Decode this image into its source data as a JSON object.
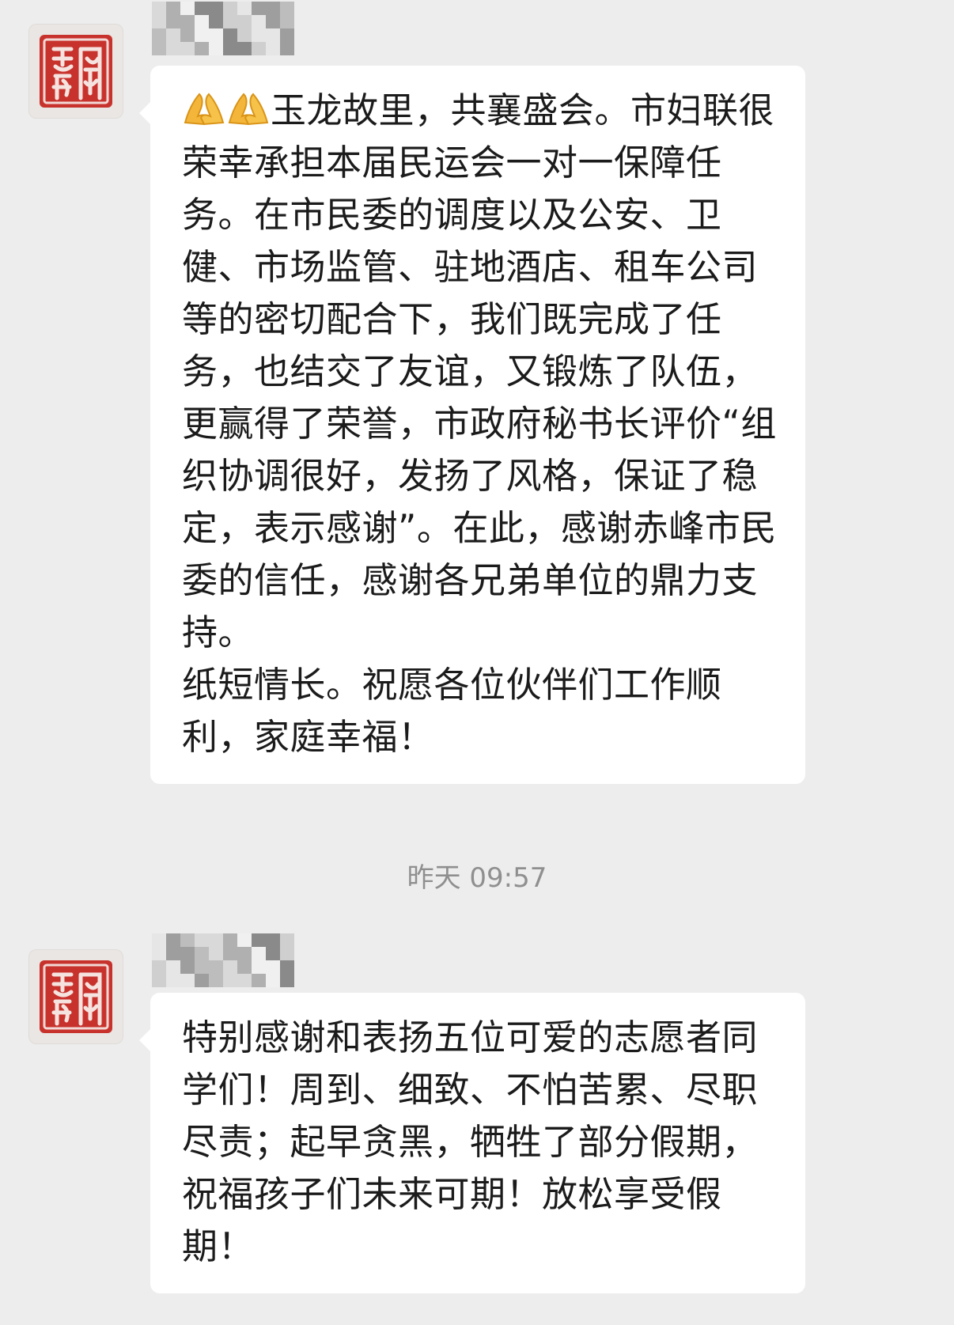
{
  "messages": [
    {
      "sender_avatar": "red-seal-avatar",
      "icons": [
        "folded-hands-emoji",
        "folded-hands-emoji"
      ],
      "paragraphs": [
        "玉龙故里，共襄盛会。市妇联很荣幸承担本届民运会一对一保障任务。在市民委的调度以及公安、卫健、市场监管、驻地酒店、租车公司等的密切配合下，我们既完成了任务，也结交了友谊，又锻炼了队伍，更赢得了荣誉，市政府秘书长评价“组织协调很好，发扬了风格，保证了稳定，表示感谢”。在此，感谢赤峰市民委的信任，感谢各兄弟单位的鼎力支持。",
        "纸短情长。祝愿各位伙伴们工作顺利，家庭幸福！"
      ]
    },
    {
      "sender_avatar": "red-seal-avatar",
      "paragraphs": [
        "特别感谢和表扬五位可爱的志愿者同学们！周到、细致、不怕苦累、尽职尽责；起早贪黑，牺牲了部分假期，祝福孩子们未来可期！放松享受假期！"
      ]
    }
  ],
  "timestamp": "昨天 09:57",
  "colors": {
    "background": "#ededed",
    "bubble": "#ffffff",
    "seal_red": "#c8322c",
    "timestamp": "#8f8f8f"
  }
}
